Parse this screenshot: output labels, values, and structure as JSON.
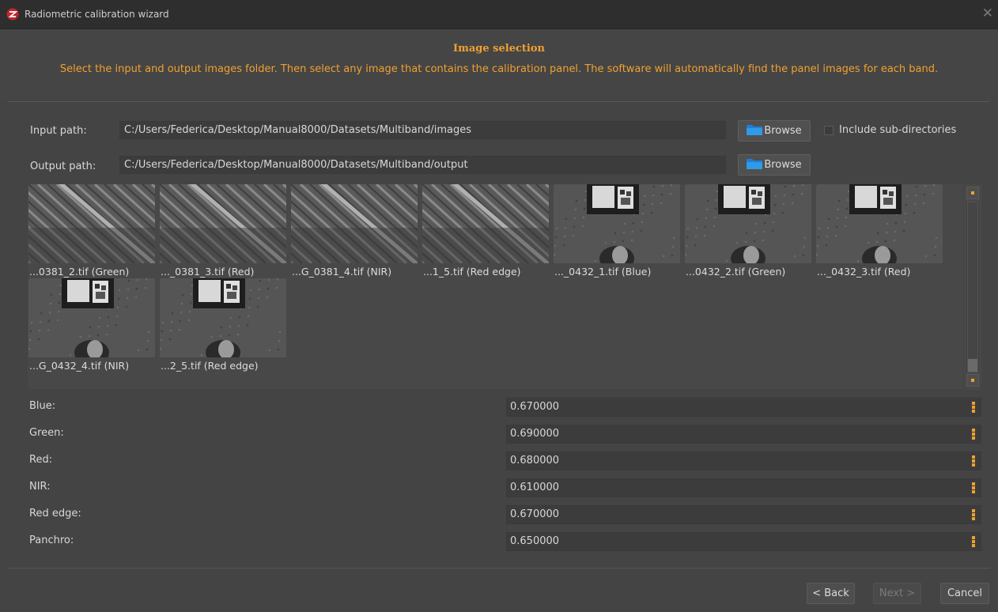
{
  "window": {
    "title": "Radiometric calibration wizard",
    "close_glyph": "✕",
    "logo_icon": "red-app-logo"
  },
  "header": {
    "title": "Image selection",
    "description": "Select the input and output images folder. Then select any image that contains the calibration panel. The software will automatically find the panel images for each band."
  },
  "paths": {
    "input_label": "Input path:",
    "input_value": "C:/Users/Federica/Desktop/Manual8000/Datasets/Multiband/images",
    "output_label": "Output path:",
    "output_value": "C:/Users/Federica/Desktop/Manual8000/Datasets/Multiband/output",
    "browse_label": "Browse",
    "include_subdirs_label": "Include sub-directories",
    "include_subdirs_checked": false
  },
  "thumbnails": [
    {
      "caption": "...0381_2.tif (Green)",
      "kind": "field"
    },
    {
      "caption": "..._0381_3.tif (Red)",
      "kind": "field"
    },
    {
      "caption": "...G_0381_4.tif (NIR)",
      "kind": "field"
    },
    {
      "caption": "...1_5.tif (Red edge)",
      "kind": "field"
    },
    {
      "caption": "..._0432_1.tif (Blue)",
      "kind": "panel"
    },
    {
      "caption": "...0432_2.tif (Green)",
      "kind": "panel"
    },
    {
      "caption": "..._0432_3.tif (Red)",
      "kind": "panel"
    },
    {
      "caption": "...G_0432_4.tif (NIR)",
      "kind": "panel"
    },
    {
      "caption": "...2_5.tif (Red edge)",
      "kind": "panel"
    }
  ],
  "bands": [
    {
      "label": "Blue:",
      "value": "0.670000"
    },
    {
      "label": "Green:",
      "value": "0.690000"
    },
    {
      "label": "Red:",
      "value": "0.680000"
    },
    {
      "label": "NIR:",
      "value": "0.610000"
    },
    {
      "label": "Red edge:",
      "value": "0.670000"
    },
    {
      "label": "Panchro:",
      "value": "0.650000"
    }
  ],
  "footer": {
    "back_label": "< Back",
    "next_label": "Next >",
    "next_enabled": false,
    "cancel_label": "Cancel"
  },
  "colors": {
    "accent": "#f0a030",
    "background": "#444444",
    "field": "#3c3c3c"
  }
}
